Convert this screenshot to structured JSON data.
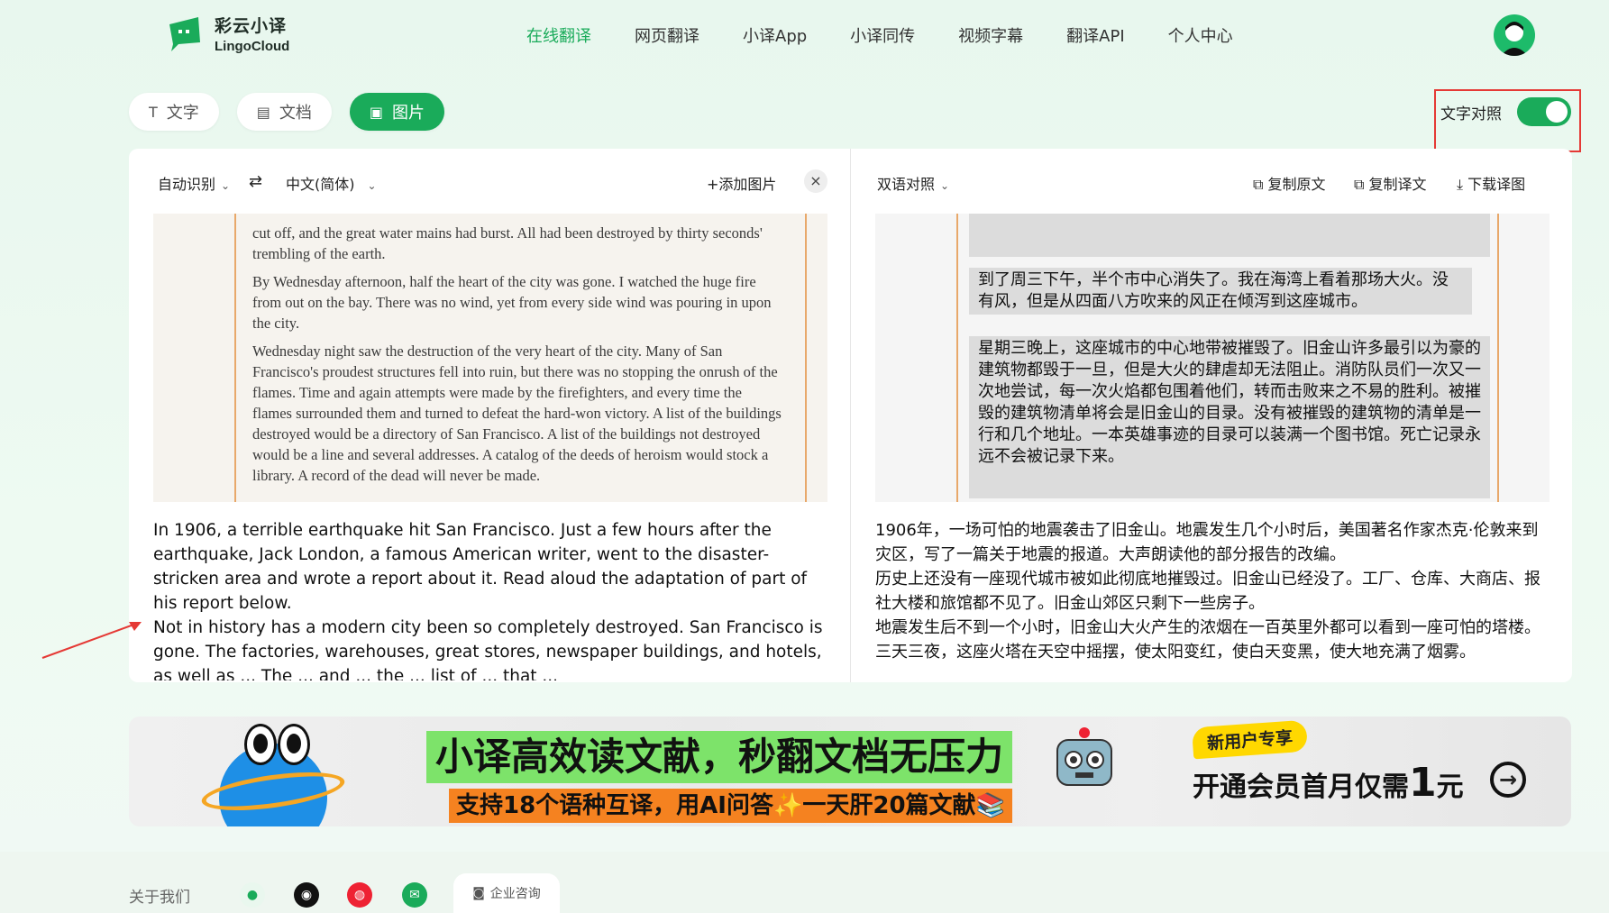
{
  "brand": {
    "name_cn": "彩云小译",
    "name_en": "LingoCloud",
    "accent": "#1aab5a"
  },
  "nav": [
    {
      "label": "在线翻译",
      "active": true
    },
    {
      "label": "网页翻译"
    },
    {
      "label": "小译App"
    },
    {
      "label": "小译同传"
    },
    {
      "label": "视频字幕"
    },
    {
      "label": "翻译API"
    },
    {
      "label": "个人中心"
    }
  ],
  "mode_tabs": [
    {
      "label": "文字",
      "icon": "text-icon"
    },
    {
      "label": "文档",
      "icon": "document-icon"
    },
    {
      "label": "图片",
      "icon": "image-icon",
      "active": true
    }
  ],
  "compare_toggle": {
    "label": "文字对照",
    "on": true
  },
  "left_toolbar": {
    "source_lang": "自动识别",
    "target_lang": "中文(简体)",
    "add_image": "+添加图片"
  },
  "right_toolbar": {
    "view_mode": "双语对照",
    "copy_source": "复制原文",
    "copy_translation": "复制译文",
    "download": "下载译图"
  },
  "source_image_paragraphs": [
    "cut off, and the great water mains had burst. All had been destroyed by thirty seconds' trembling of the earth.",
    "By Wednesday afternoon, half the heart of the city was gone. I watched the huge fire from out on the bay. There was no wind, yet from every side wind was pouring in upon the city.",
    "Wednesday night saw the destruction of the very heart of the city. Many of San Francisco's proudest structures fell into ruin, but there was no stopping the onrush of the flames. Time and again attempts were made by the firefighters, and every time the flames surrounded them and turned to defeat the hard-won victory. A list of the buildings destroyed would be a directory of San Francisco. A list of the buildings not destroyed would be a line and several addresses. A catalog of the deeds of heroism would stock a library. A record of the dead will never be made."
  ],
  "translated_image_paragraphs": [
    "到了周三下午，半个市中心消失了。我在海湾上看着那场大火。没有风，但是从四面八方吹来的风正在倾泻到这座城市。",
    "星期三晚上，这座城市的中心地带被摧毁了。旧金山许多最引以为豪的建筑物都毁于一旦，但是大火的肆虐却无法阻止。消防队员们一次又一次地尝试，每一次火焰都包围着他们，转而击败来之不易的胜利。被摧毁的建筑物清单将会是旧金山的目录。没有被摧毁的建筑物的清单是一行和几个地址。一本英雄事迹的目录可以装满一个图书馆。死亡记录永远不会被记录下来。"
  ],
  "source_text": [
    "In 1906, a terrible earthquake hit San Francisco. Just a few hours after the earthquake, Jack London, a famous American writer, went to the disaster-stricken area and wrote a report about it. Read aloud the adaptation of part of his report below.",
    "Not in history has a modern city been so completely destroyed. San Francisco is gone. The factories, warehouses, great stores, newspaper buildings, and hotels, as well as ... The ... and ... the ... list of ... that ..."
  ],
  "translated_text": [
    "1906年，一场可怕的地震袭击了旧金山。地震发生几个小时后，美国著名作家杰克·伦敦来到灾区，写了一篇关于地震的报道。大声朗读他的部分报告的改编。",
    "历史上还没有一座现代城市被如此彻底地摧毁过。旧金山已经没了。工厂、仓库、大商店、报社大楼和旅馆都不见了。旧金山郊区只剩下一些房子。",
    "地震发生后不到一个小时，旧金山大火产生的浓烟在一百英里外都可以看到一座可怕的塔楼。三天三夜，这座火塔在天空中摇摆，使太阳变红，使白天变黑，使大地充满了烟雾。"
  ],
  "banner": {
    "headline": "小译高效读文献，秒翻文档无压力",
    "subline": "支持18个语种互译，用AI问答✨一天肝20篇文献📚",
    "badge": "新用户专享",
    "promo_prefix": "开通会员首月仅需",
    "promo_num": "1",
    "promo_suffix": "元"
  },
  "footer": {
    "about": "关于我们",
    "social_icons": [
      "wechat-icon",
      "qq-icon",
      "weibo-icon",
      "email-icon"
    ],
    "enterprise": "企业咨询"
  }
}
